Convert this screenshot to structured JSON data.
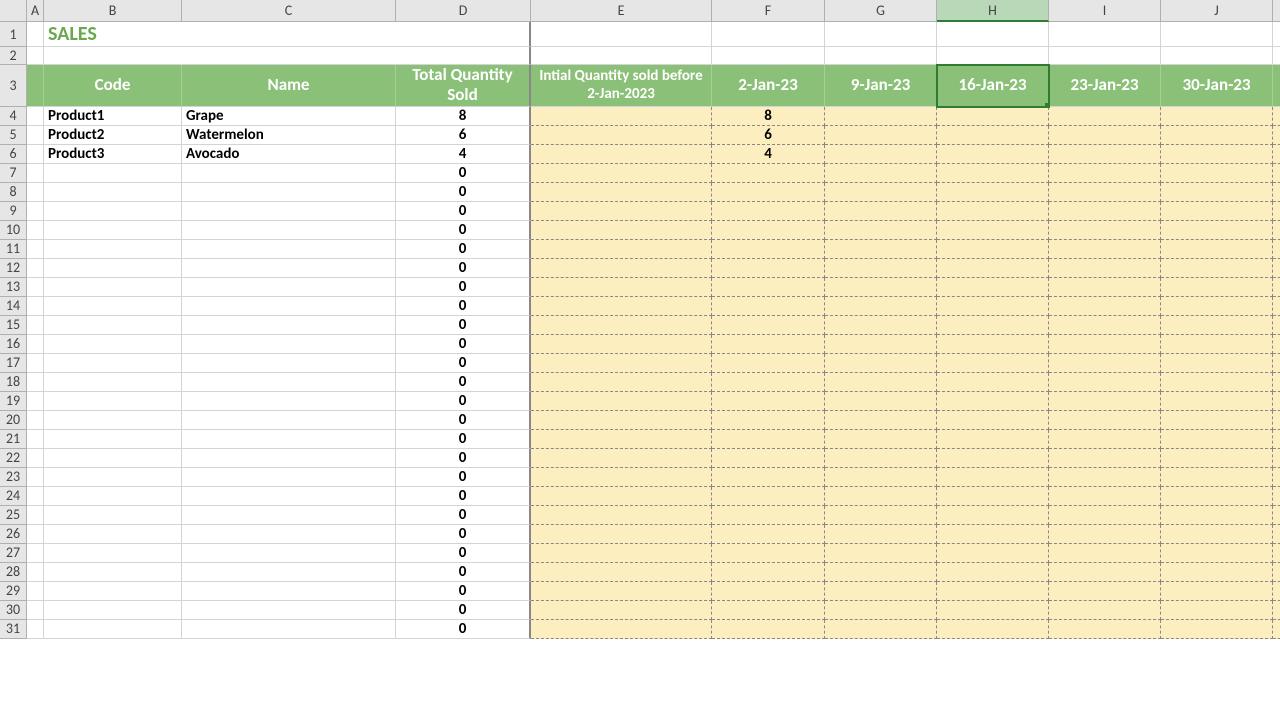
{
  "columns": [
    "A",
    "B",
    "C",
    "D",
    "E",
    "F",
    "G",
    "H",
    "I",
    "J"
  ],
  "title": "SALES",
  "headers": {
    "code": "Code",
    "name": "Name",
    "total": "Total Quantity Sold",
    "initial": "Intial Quantity sold before 2-Jan-2023",
    "dates": [
      "2-Jan-23",
      "9-Jan-23",
      "16-Jan-23",
      "23-Jan-23",
      "30-Jan-23"
    ]
  },
  "rows": [
    {
      "code": "Product1",
      "name": "Grape",
      "total": "8",
      "qty": "8"
    },
    {
      "code": "Product2",
      "name": "Watermelon",
      "total": "6",
      "qty": "6"
    },
    {
      "code": "Product3",
      "name": "Avocado",
      "total": "4",
      "qty": "4"
    }
  ],
  "zero": "0",
  "row_count": 31,
  "selected_col": "H",
  "selected_row": 3
}
